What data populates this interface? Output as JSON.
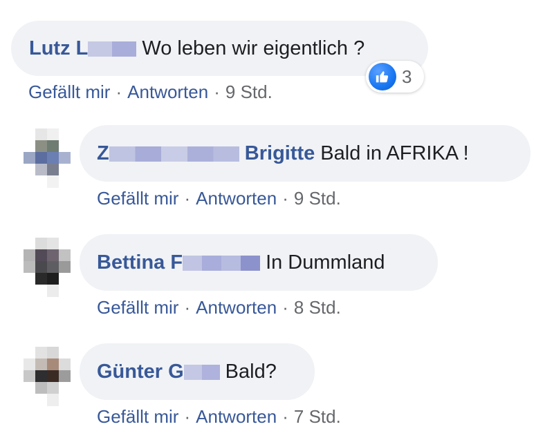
{
  "colors": {
    "bubble_bg": "#f0f2f5",
    "author": "#385898",
    "meta": "#65676b",
    "like_blue": "#1877f2"
  },
  "action_labels": {
    "like": "Gefällt mir",
    "reply": "Antworten",
    "separator": "·"
  },
  "comments": [
    {
      "author_visible": "Lutz L",
      "text": "Wo leben wir eigentlich ?",
      "time": "9 Std.",
      "reactions": {
        "icon": "like-icon",
        "count": "3"
      }
    },
    {
      "author_visible_prefix": "Z",
      "author_visible_suffix": "Brigitte",
      "text": "Bald in AFRIKA !",
      "time": "9 Std."
    },
    {
      "author_visible": "Bettina F",
      "text": "In Dummland",
      "time": "8 Std."
    },
    {
      "author_visible": "Günter G",
      "text": "Bald?",
      "time": "7 Std."
    }
  ]
}
